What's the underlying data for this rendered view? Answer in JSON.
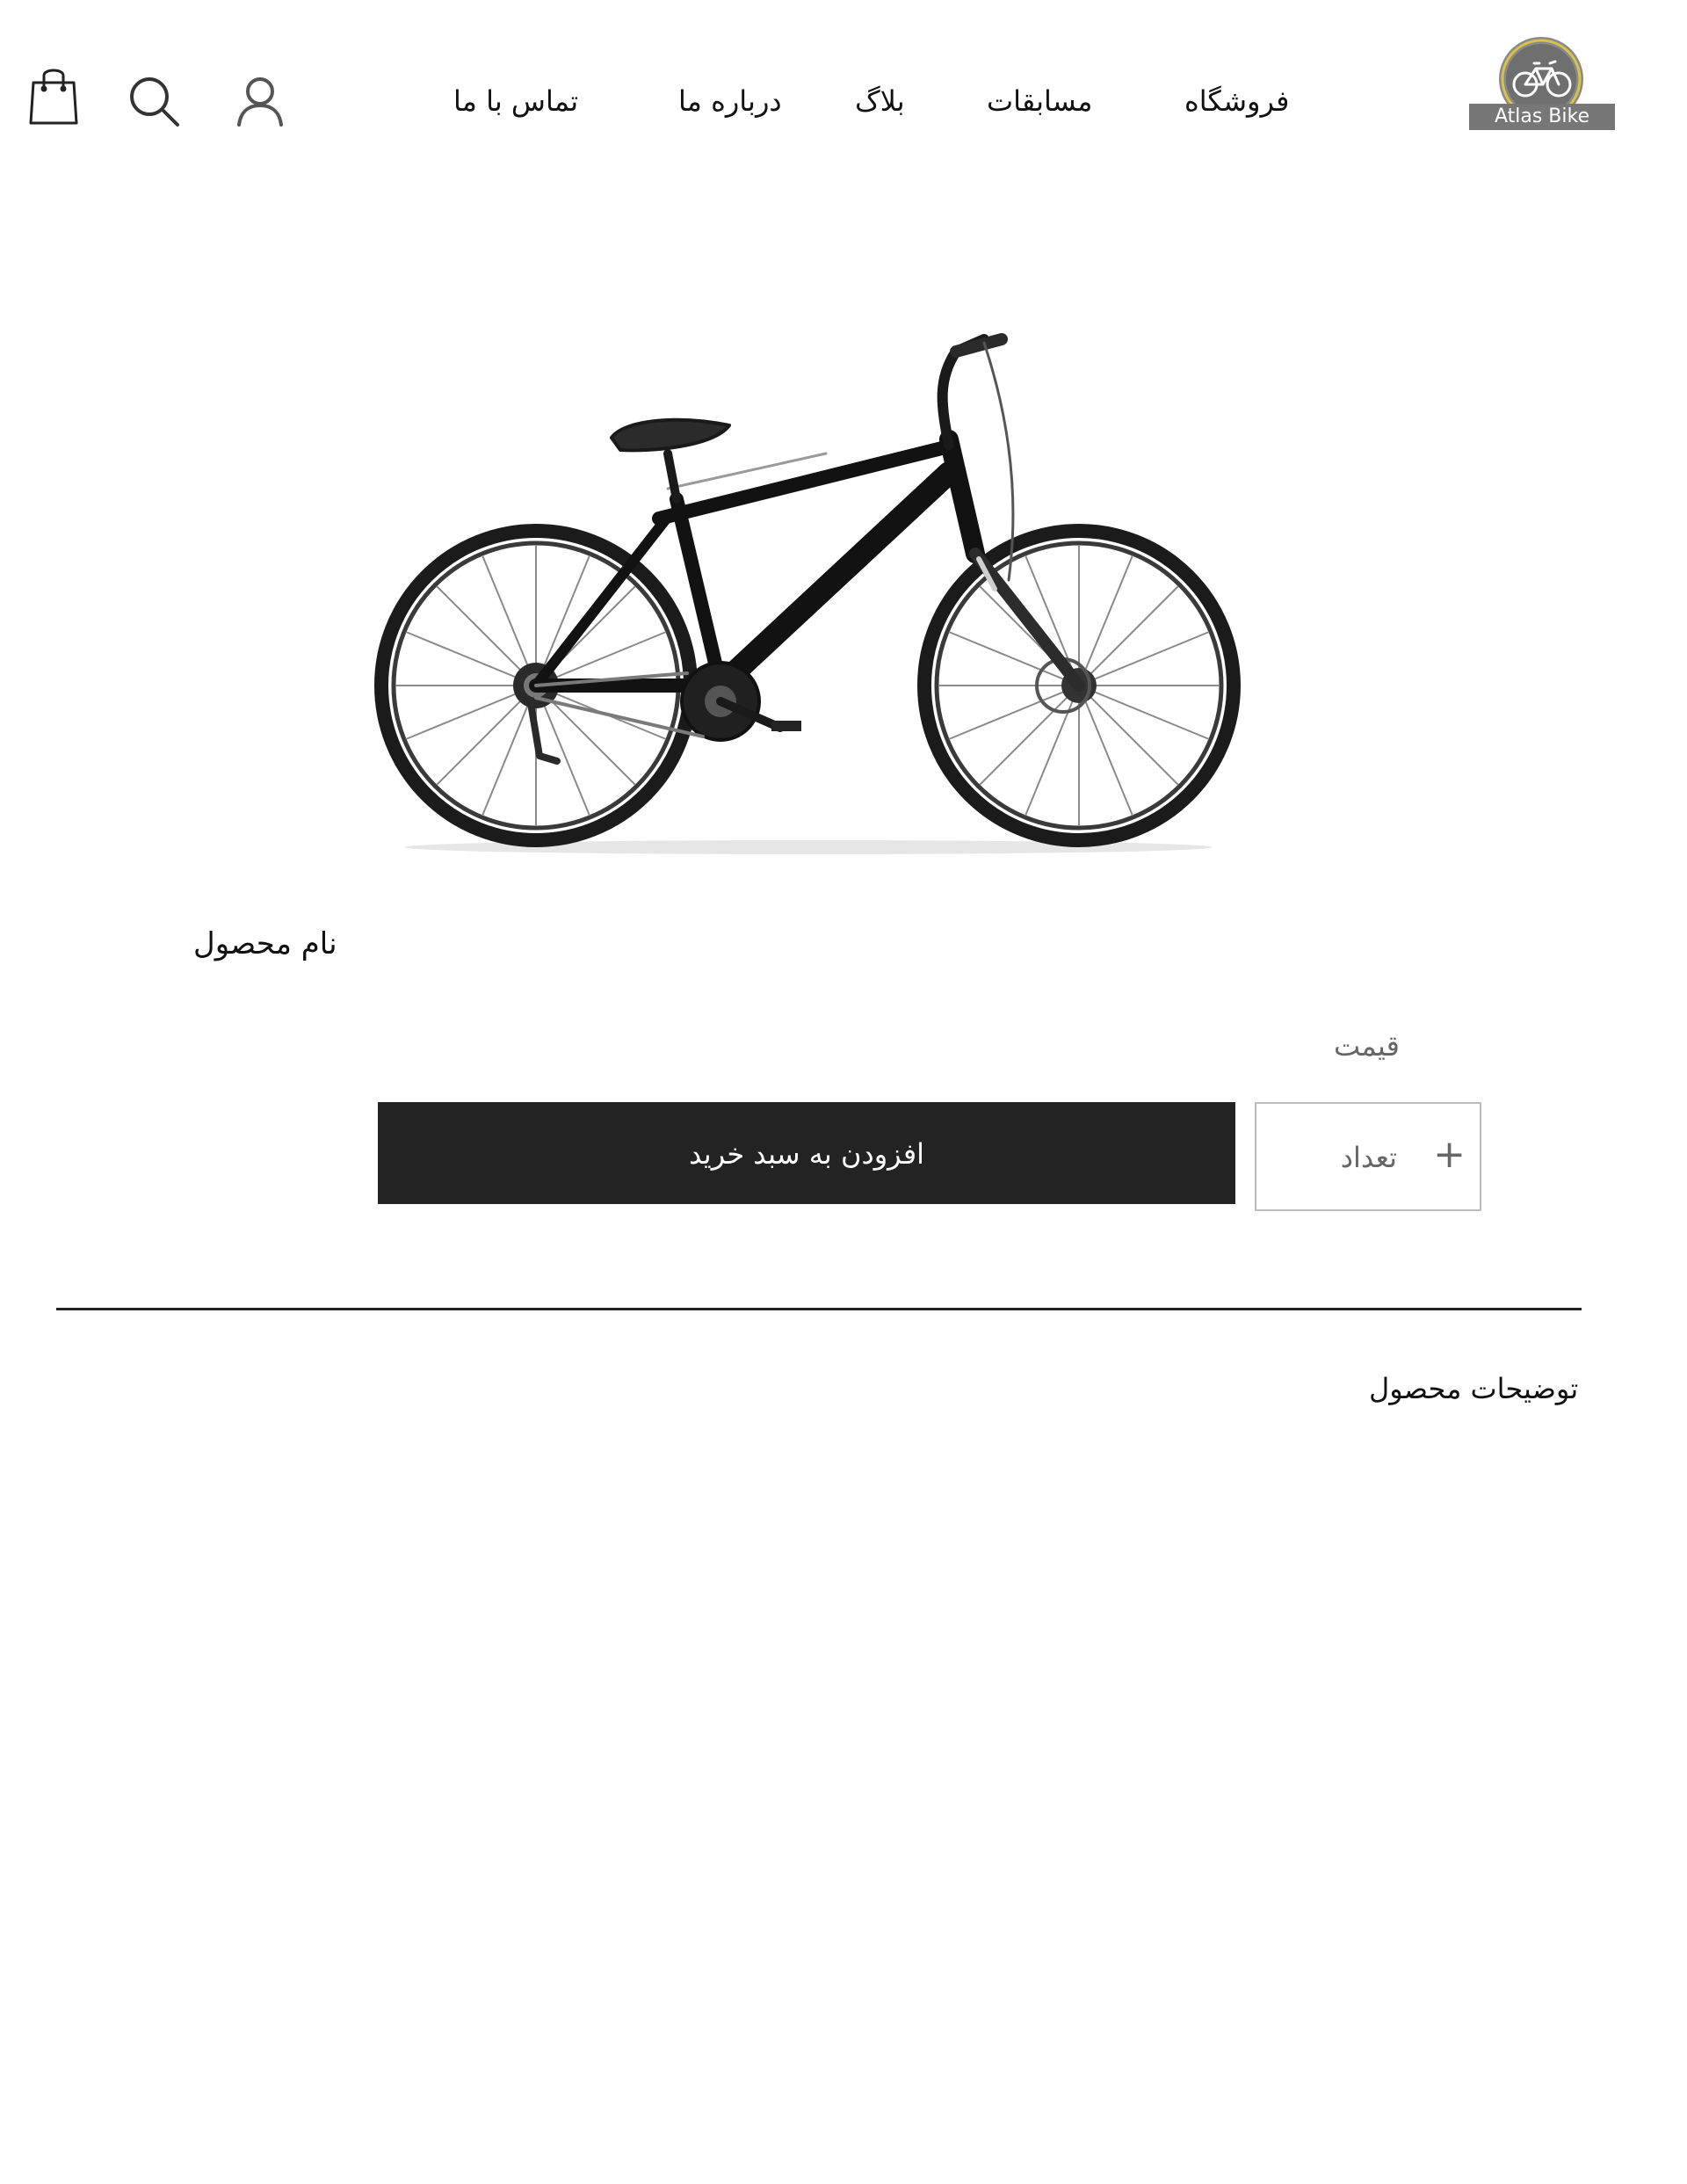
{
  "header": {
    "logo": {
      "text": "Atlas Bike",
      "icon": "bicycle-logo-icon"
    },
    "nav": [
      {
        "label": "فروشگاه"
      },
      {
        "label": "مسابقات"
      },
      {
        "label": "بلاگ"
      },
      {
        "label": "درباره ما"
      },
      {
        "label": "تماس با ما"
      }
    ],
    "icons": {
      "user": "user-icon",
      "search": "search-icon",
      "cart": "shopping-bag-icon"
    }
  },
  "product": {
    "image": "bicycle-product-image",
    "name": "نام محصول",
    "price_label": "قیمت",
    "quantity": {
      "label": "تعداد",
      "increment": "+"
    },
    "add_to_cart_label": "افزودن به سبد خرید"
  },
  "description": {
    "title": "توضیحات محصول"
  },
  "colors": {
    "button_bg": "#232323",
    "logo_badge": "#777777",
    "logo_ring": "#d8c24a",
    "muted_text": "#666666",
    "divider": "#222222"
  }
}
